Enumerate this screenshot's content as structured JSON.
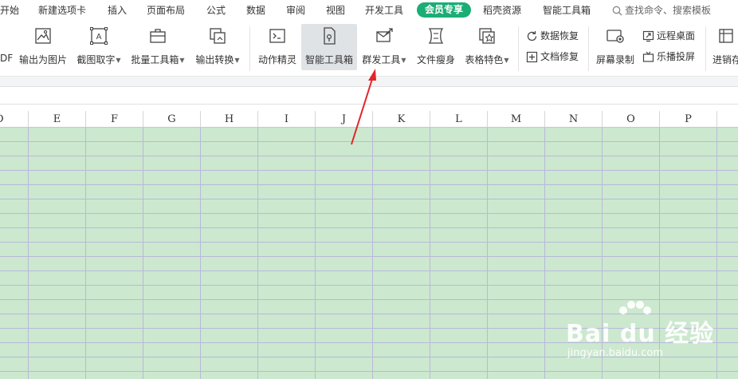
{
  "menu": {
    "items": [
      "开始",
      "新建选项卡",
      "插入",
      "页面布局",
      "公式",
      "数据",
      "审阅",
      "视图",
      "开发工具",
      "会员专享",
      "稻壳资源",
      "智能工具箱"
    ],
    "search_placeholder": "查找命令、搜索模板"
  },
  "ribbon": {
    "tools": [
      {
        "label": "DF"
      },
      {
        "label": "输出为图片"
      },
      {
        "label": "截图取字"
      },
      {
        "label": "批量工具箱"
      },
      {
        "label": "输出转换"
      },
      {
        "label": "动作精灵"
      },
      {
        "label": "智能工具箱"
      },
      {
        "label": "群发工具"
      },
      {
        "label": "文件瘦身"
      },
      {
        "label": "表格特色"
      },
      {
        "label": "屏幕录制"
      },
      {
        "label": "进销存"
      }
    ],
    "small_tools": [
      {
        "label": "数据恢复"
      },
      {
        "label": "文档修复"
      },
      {
        "label": "远程桌面"
      },
      {
        "label": "乐播投屏"
      }
    ]
  },
  "sheet": {
    "columns": [
      "D",
      "E",
      "F",
      "G",
      "H",
      "I",
      "J",
      "K",
      "L",
      "M",
      "N",
      "O",
      "P"
    ]
  },
  "colors": {
    "accent": "#1aad75",
    "cell_bg": "#cce8cf",
    "arrow": "#e0262a"
  },
  "watermark": {
    "brand": "Bai du 经验",
    "url": "jingyan.baidu.com"
  }
}
